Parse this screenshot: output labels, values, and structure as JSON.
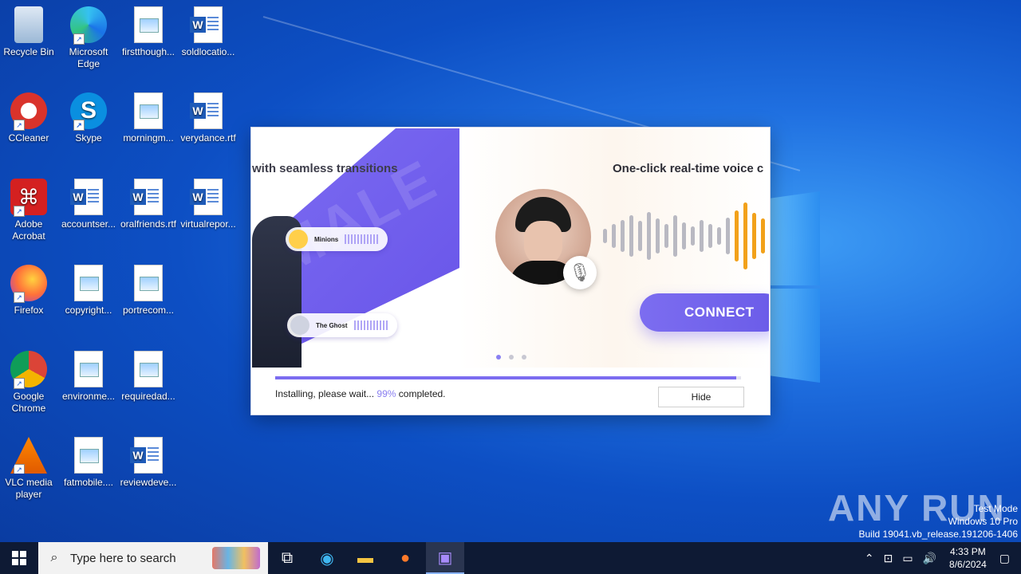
{
  "desktop_icons": [
    {
      "label": "Recycle Bin",
      "icon": "recycle-bin-icon"
    },
    {
      "label": "Microsoft Edge",
      "icon": "edge-icon"
    },
    {
      "label": "firstthough...",
      "icon": "image-file-icon"
    },
    {
      "label": "soldlocatio...",
      "icon": "word-doc-icon"
    },
    {
      "label": "CCleaner",
      "icon": "ccleaner-icon"
    },
    {
      "label": "Skype",
      "icon": "skype-icon"
    },
    {
      "label": "morningm...",
      "icon": "image-file-icon"
    },
    {
      "label": "verydance.rtf",
      "icon": "word-doc-icon"
    },
    {
      "label": "Adobe Acrobat",
      "icon": "acrobat-icon"
    },
    {
      "label": "accountser...",
      "icon": "word-doc-icon"
    },
    {
      "label": "oralfriends.rtf",
      "icon": "word-doc-icon"
    },
    {
      "label": "virtualrepor...",
      "icon": "word-doc-icon"
    },
    {
      "label": "Firefox",
      "icon": "firefox-icon"
    },
    {
      "label": "copyright...",
      "icon": "image-file-icon"
    },
    {
      "label": "portrecom...",
      "icon": "image-file-icon"
    },
    {
      "label": "Google Chrome",
      "icon": "chrome-icon"
    },
    {
      "label": "environme...",
      "icon": "image-file-icon"
    },
    {
      "label": "requiredad...",
      "icon": "image-file-icon"
    },
    {
      "label": "VLC media player",
      "icon": "vlc-icon"
    },
    {
      "label": "fatmobile....",
      "icon": "image-file-icon"
    },
    {
      "label": "reviewdeve...",
      "icon": "word-doc-icon"
    }
  ],
  "installer": {
    "slide_left_text": "with seamless transitions",
    "slide_right_text": "One-click real-time voice c",
    "bg_word": "MALE",
    "voice_minions": "Minions",
    "voice_ghost": "The Ghost",
    "connect_label": "CONNECT",
    "progress_fraction": 0.99,
    "status_prefix": "Installing, please wait...",
    "status_percent": "99%",
    "status_suffix": "completed.",
    "hide_label": "Hide",
    "accent": "#7b6cf0"
  },
  "watermark": "ANY RUN",
  "system_info": {
    "line1": "Test Mode",
    "line2": "Windows 10 Pro",
    "line3": "Build 19041.vb_release.191206-1406"
  },
  "taskbar": {
    "search_placeholder": "Type here to search",
    "time": "4:33 PM",
    "date": "8/6/2024"
  }
}
